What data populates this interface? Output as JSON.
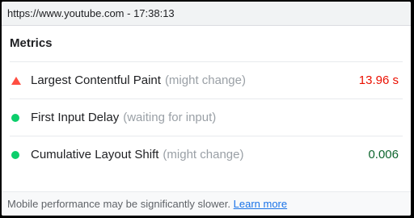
{
  "url_bar": {
    "text": "https://www.youtube.com - 17:38:13"
  },
  "panel": {
    "title": "Metrics"
  },
  "metrics": [
    {
      "name": "Largest Contentful Paint",
      "note": "(might change)",
      "value": "13.96 s",
      "status": "poor",
      "icon": "warning-triangle-icon",
      "value_color": "#eb0f00",
      "icon_color": "#ff4e42"
    },
    {
      "name": "First Input Delay",
      "note": "(waiting for input)",
      "value": "",
      "status": "good",
      "icon": "status-dot-icon",
      "value_color": "#0d652d",
      "icon_color": "#0cce6b"
    },
    {
      "name": "Cumulative Layout Shift",
      "note": "(might change)",
      "value": "0.006",
      "status": "good",
      "icon": "status-dot-icon",
      "value_color": "#0d652d",
      "icon_color": "#0cce6b"
    }
  ],
  "footer": {
    "text": "Mobile performance may be significantly slower.",
    "link_label": "Learn more"
  }
}
